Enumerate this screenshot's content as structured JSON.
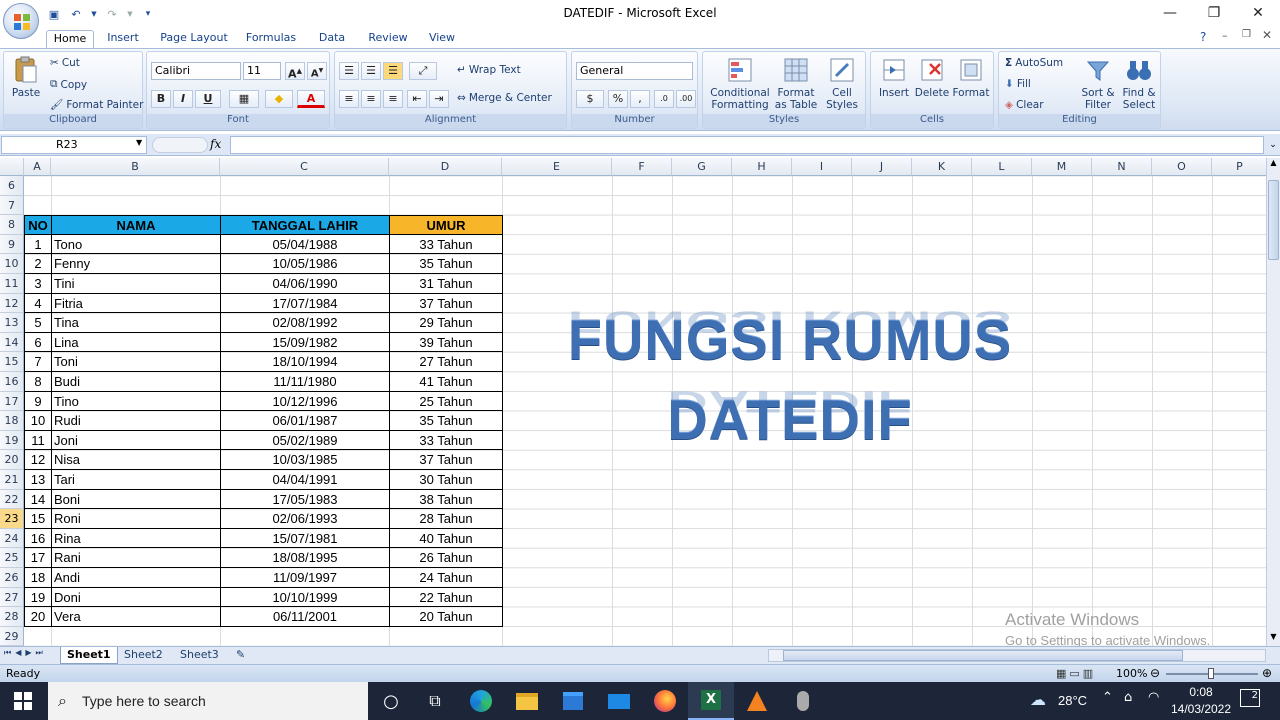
{
  "window": {
    "title": "DATEDIF - Microsoft Excel"
  },
  "tabs": [
    "Home",
    "Insert",
    "Page Layout",
    "Formulas",
    "Data",
    "Review",
    "View"
  ],
  "ribbon": {
    "clipboard": {
      "paste": "Paste",
      "cut": "Cut",
      "copy": "Copy",
      "format_painter": "Format Painter",
      "label": "Clipboard"
    },
    "font": {
      "name": "Calibri",
      "size": "11",
      "label": "Font"
    },
    "alignment": {
      "wrap_text": "Wrap Text",
      "merge_center": "Merge & Center",
      "label": "Alignment"
    },
    "number": {
      "format": "General",
      "label": "Number"
    },
    "styles": {
      "conditional": "Conditional",
      "conditional2": "Formatting",
      "format_table": "Format",
      "format_table2": "as Table",
      "cell_styles": "Cell",
      "cell_styles2": "Styles",
      "label": "Styles"
    },
    "cells": {
      "insert": "Insert",
      "delete": "Delete",
      "format": "Format",
      "label": "Cells"
    },
    "editing": {
      "autosum": "AutoSum",
      "fill": "Fill",
      "clear": "Clear",
      "sort": "Sort &",
      "sort2": "Filter",
      "find": "Find &",
      "find2": "Select",
      "label": "Editing"
    }
  },
  "formula_bar": {
    "name_box": "R23",
    "fx": "fx",
    "formula": ""
  },
  "columns": [
    "A",
    "B",
    "C",
    "D",
    "E",
    "F",
    "G",
    "H",
    "I",
    "J",
    "K",
    "L",
    "M",
    "N",
    "O",
    "P"
  ],
  "rows": [
    "6",
    "7",
    "8",
    "9",
    "10",
    "11",
    "12",
    "13",
    "14",
    "15",
    "16",
    "17",
    "18",
    "19",
    "20",
    "21",
    "22",
    "23",
    "24",
    "25",
    "26",
    "27",
    "28",
    "29"
  ],
  "table": {
    "headers": {
      "no": "NO",
      "nama": "NAMA",
      "tanggal": "TANGGAL LAHIR",
      "umur": "UMUR"
    },
    "rows": [
      [
        "1",
        "Tono",
        "05/04/1988",
        "33 Tahun"
      ],
      [
        "2",
        "Fenny",
        "10/05/1986",
        "35 Tahun"
      ],
      [
        "3",
        "Tini",
        "04/06/1990",
        "31 Tahun"
      ],
      [
        "4",
        "Fitria",
        "17/07/1984",
        "37 Tahun"
      ],
      [
        "5",
        "Tina",
        "02/08/1992",
        "29 Tahun"
      ],
      [
        "6",
        "Lina",
        "15/09/1982",
        "39 Tahun"
      ],
      [
        "7",
        "Toni",
        "18/10/1994",
        "27 Tahun"
      ],
      [
        "8",
        "Budi",
        "11/11/1980",
        "41 Tahun"
      ],
      [
        "9",
        "Tino",
        "10/12/1996",
        "25 Tahun"
      ],
      [
        "10",
        "Rudi",
        "06/01/1987",
        "35 Tahun"
      ],
      [
        "11",
        "Joni",
        "05/02/1989",
        "33 Tahun"
      ],
      [
        "12",
        "Nisa",
        "10/03/1985",
        "37 Tahun"
      ],
      [
        "13",
        "Tari",
        "04/04/1991",
        "30 Tahun"
      ],
      [
        "14",
        "Boni",
        "17/05/1983",
        "38 Tahun"
      ],
      [
        "15",
        "Roni",
        "02/06/1993",
        "28 Tahun"
      ],
      [
        "16",
        "Rina",
        "15/07/1981",
        "40 Tahun"
      ],
      [
        "17",
        "Rani",
        "18/08/1995",
        "26 Tahun"
      ],
      [
        "18",
        "Andi",
        "11/09/1997",
        "24 Tahun"
      ],
      [
        "19",
        "Doni",
        "10/10/1999",
        "22 Tahun"
      ],
      [
        "20",
        "Vera",
        "06/11/2001",
        "20 Tahun"
      ]
    ]
  },
  "overlay": {
    "line1": "FUNGSI RUMUS",
    "line2": "DATEDIF"
  },
  "sheets": [
    "Sheet1",
    "Sheet2",
    "Sheet3"
  ],
  "status": {
    "ready": "Ready",
    "zoom": "100%"
  },
  "watermark": {
    "line1": "Activate Windows",
    "line2": "Go to Settings to activate Windows."
  },
  "taskbar": {
    "search_placeholder": "Type here to search",
    "weather": "28°C",
    "time": "0:08",
    "date": "14/03/2022",
    "notifications": "2"
  },
  "colors": {
    "header_blue": "#1aa8e6",
    "header_orange": "#f7b52a",
    "title_blue": "#3d6fb2"
  }
}
